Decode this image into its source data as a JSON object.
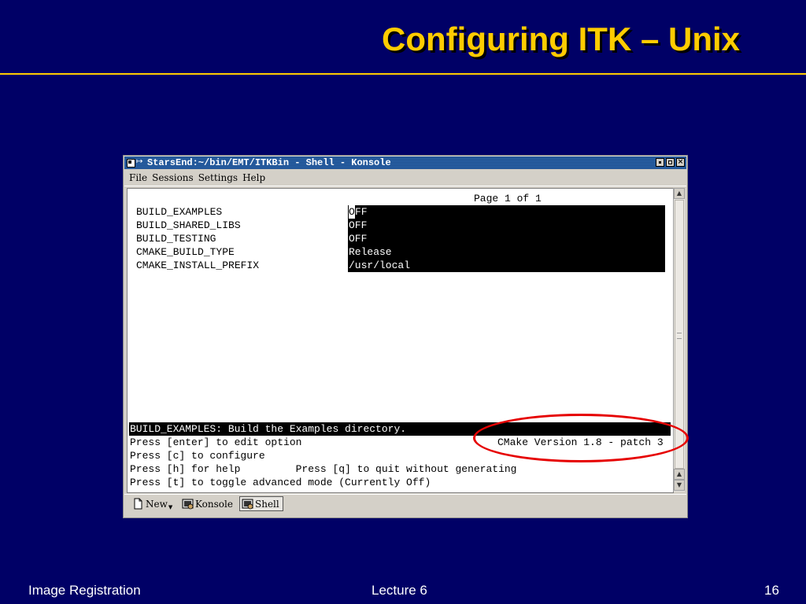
{
  "slide": {
    "title": "Configuring ITK – Unix",
    "footer_left": "Image Registration",
    "footer_center": "Lecture 6",
    "footer_right": "16"
  },
  "window": {
    "title": "StarsEnd:~/bin/EMT/ITKBin - Shell - Konsole",
    "sys_arrow": "↦",
    "buttons": {
      "minimize_icon": "minimize-icon",
      "maximize_icon": "maximize-icon",
      "close_icon": "close-icon",
      "close_glyph": "×"
    }
  },
  "menubar": {
    "items": [
      {
        "label": "File"
      },
      {
        "label": "Sessions"
      },
      {
        "label": "Settings"
      },
      {
        "label": "Help"
      }
    ]
  },
  "terminal": {
    "page_indicator": "Page 1 of 1",
    "options": [
      {
        "name": "BUILD_EXAMPLES",
        "value_cursor": "O",
        "value_rest": "FF"
      },
      {
        "name": "BUILD_SHARED_LIBS",
        "value": "OFF"
      },
      {
        "name": "BUILD_TESTING",
        "value": "OFF"
      },
      {
        "name": "CMAKE_BUILD_TYPE",
        "value": "Release"
      },
      {
        "name": "CMAKE_INSTALL_PREFIX",
        "value": "/usr/local"
      }
    ],
    "help_line": "BUILD_EXAMPLES: Build the Examples directory.",
    "instructions": [
      "Press [enter] to edit option",
      "Press [c] to configure",
      "Press [h] for help         Press [q] to quit without generating",
      "Press [t] to toggle advanced mode (Currently Off)"
    ],
    "version": "CMake Version 1.8 - patch 3"
  },
  "tabbar": {
    "new_label": "New",
    "tabs": [
      {
        "label": "Konsole",
        "active": false
      },
      {
        "label": "Shell",
        "active": true
      }
    ]
  },
  "colors": {
    "background": "#000066",
    "title": "#ffcc00",
    "annotation": "#e60000"
  }
}
